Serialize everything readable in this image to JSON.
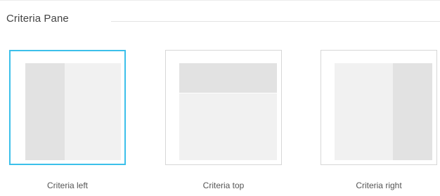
{
  "section": {
    "title": "Criteria Pane"
  },
  "options": [
    {
      "label": "Criteria left",
      "selected": true
    },
    {
      "label": "Criteria top",
      "selected": false
    },
    {
      "label": "Criteria right",
      "selected": false
    }
  ],
  "colors": {
    "accent": "#3cc0ea",
    "thumb_border": "#d7d7d7",
    "pane_fill": "#f1f1f1",
    "criteria_fill": "#e2e2e2"
  }
}
